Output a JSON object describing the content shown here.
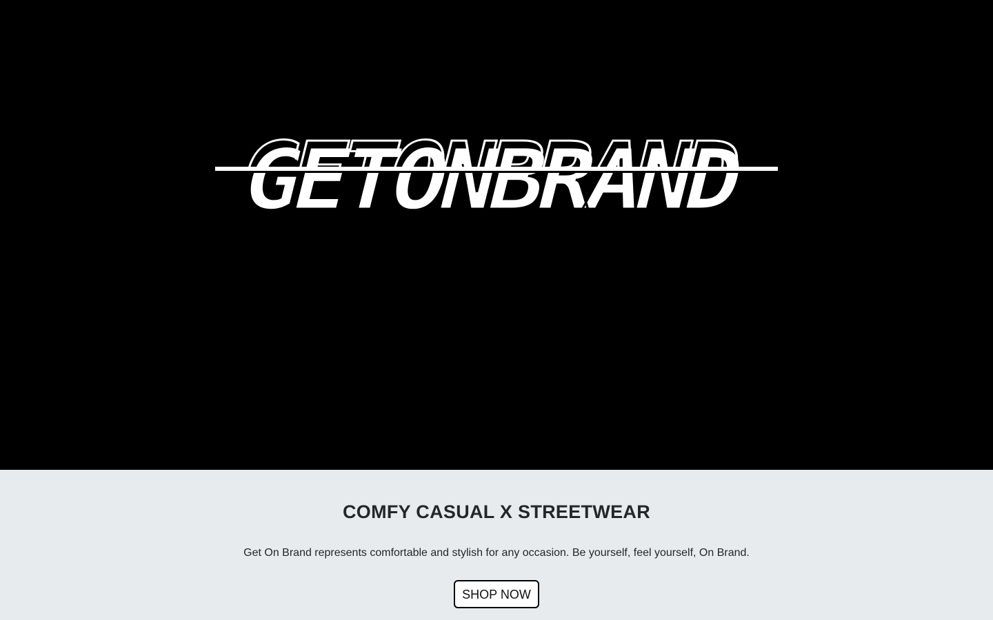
{
  "hero": {
    "logo_text": "GETONBRAND",
    "background_color": "#000000",
    "logo_color": "#ffffff"
  },
  "intro": {
    "tagline": "COMFY CASUAL X STREETWEAR",
    "description": "Get On Brand represents comfortable and stylish for any occasion. Be yourself, feel yourself, On Brand.",
    "button_label": "SHOP NOW",
    "background_color": "#e8ebee"
  }
}
